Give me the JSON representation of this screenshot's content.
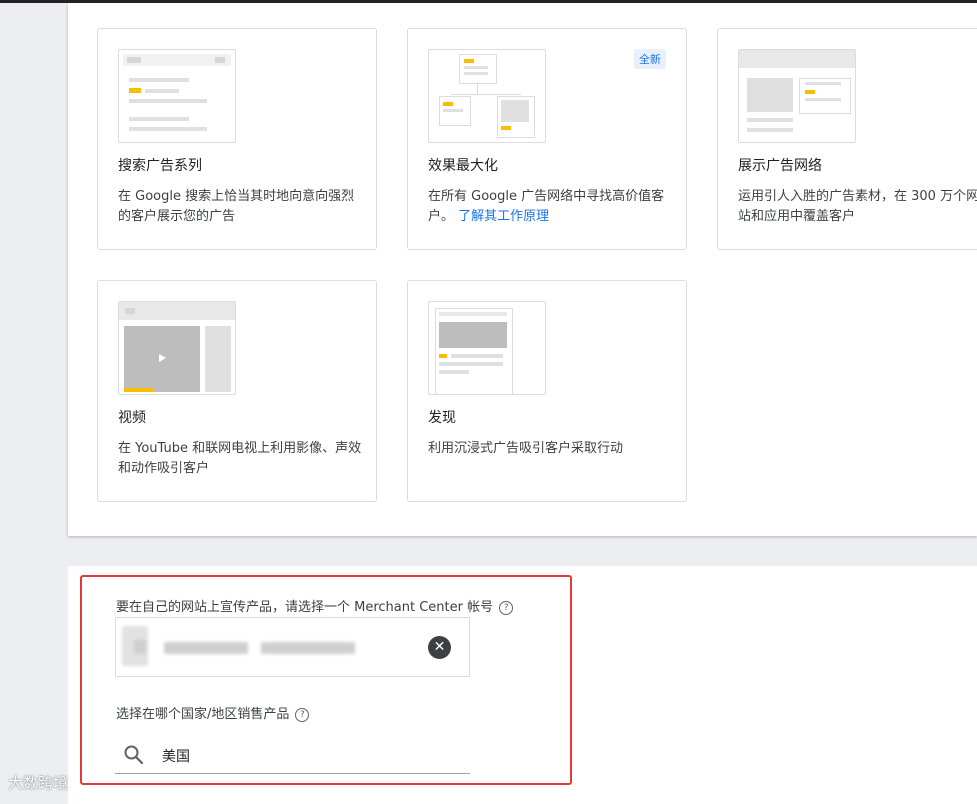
{
  "campaign_types": [
    {
      "title": "搜索广告系列",
      "desc": "在 Google 搜索上恰当其时地向意向强烈的客户展示您的广告"
    },
    {
      "title": "效果最大化",
      "desc": "在所有 Google 广告网络中寻找高价值客户。",
      "link": "了解其工作原理",
      "badge": "全新"
    },
    {
      "title": "展示广告网络",
      "desc": "运用引人入胜的广告素材，在 300 万个网站和应用中覆盖客户"
    },
    {
      "title": "视频",
      "desc": "在 YouTube 和联网电视上利用影像、声效和动作吸引客户"
    },
    {
      "title": "发现",
      "desc": "利用沉浸式广告吸引客户采取行动"
    }
  ],
  "merchant": {
    "label": "要在自己的网站上宣传产品，请选择一个 Merchant Center 帐号",
    "help": "?",
    "clear": "✕"
  },
  "country": {
    "label": "选择在哪个国家/地区销售产品",
    "help": "?",
    "value": "美国"
  },
  "watermark": "大数跨境",
  "colors": {
    "accent": "#1a73e8",
    "highlight": "#e53935",
    "thumb_yellow": "#fbbc04"
  }
}
